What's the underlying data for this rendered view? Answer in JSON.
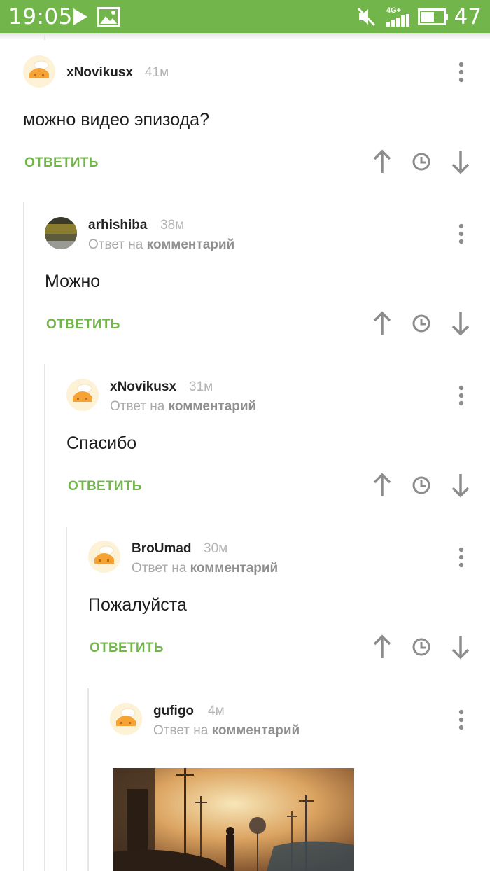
{
  "status_bar": {
    "time": "19:05",
    "network": "4G+",
    "battery": "47"
  },
  "comments": [
    {
      "author": "xNovikusx",
      "time": "41м",
      "reply_to_prefix": "",
      "reply_to_link": "",
      "text": "можно видео эпизода?",
      "reply_label": "ОТВЕТИТЬ"
    },
    {
      "author": "arhishiba",
      "time": "38м",
      "reply_to_prefix": "Ответ на",
      "reply_to_link": "комментарий",
      "text": "Можно",
      "reply_label": "ОТВЕТИТЬ"
    },
    {
      "author": "xNovikusx",
      "time": "31м",
      "reply_to_prefix": "Ответ на",
      "reply_to_link": "комментарий",
      "text": "Спасибо",
      "reply_label": "ОТВЕТИТЬ"
    },
    {
      "author": "BroUmad",
      "time": "30м",
      "reply_to_prefix": "Ответ на",
      "reply_to_link": "комментарий",
      "text": "Пожалуйста",
      "reply_label": "ОТВЕТИТЬ"
    },
    {
      "author": "gufigo",
      "time": "4м",
      "reply_to_prefix": "Ответ на",
      "reply_to_link": "комментарий",
      "text": "",
      "reply_label": ""
    }
  ],
  "colors": {
    "status_bar": "#72b54a",
    "reply": "#72b54a",
    "icon_gray": "#8c8c8c"
  },
  "icons": [
    "play-icon",
    "image-icon",
    "mute-icon",
    "signal-icon",
    "battery-icon",
    "more-vert-icon",
    "arrow-up-icon",
    "clock-icon",
    "arrow-down-icon"
  ]
}
